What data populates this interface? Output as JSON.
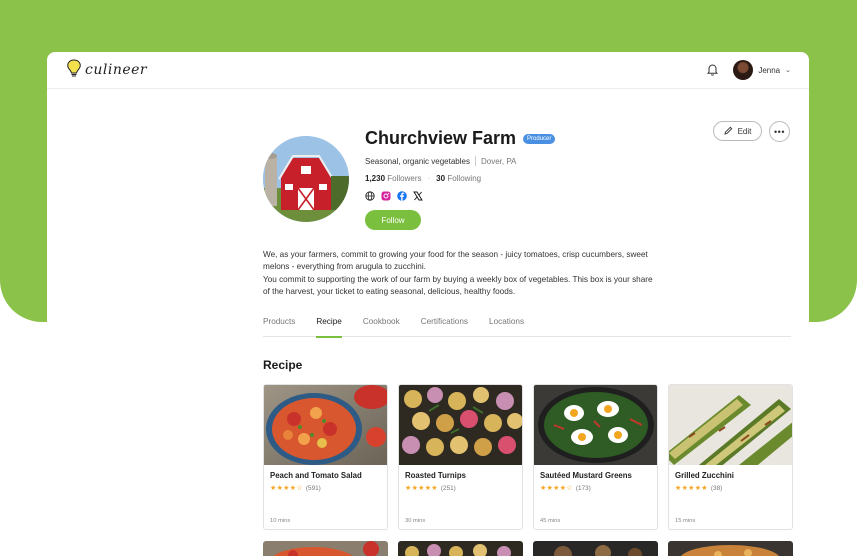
{
  "app": {
    "logo_text": "culineer"
  },
  "header": {
    "user_name": "Jenna"
  },
  "profile": {
    "name": "Churchview Farm",
    "badge": "Producer",
    "tagline": "Seasonal, organic vegetables",
    "location": "Dover, PA",
    "followers_count": "1,230",
    "followers_label": "Followers",
    "following_count": "30",
    "following_label": "Following",
    "follow_label": "Follow",
    "edit_label": "Edit",
    "more_label": "•••",
    "socials": [
      "globe-icon",
      "instagram-icon",
      "facebook-icon",
      "x-icon"
    ],
    "description": [
      "We, as your farmers, commit to growing your food for the season - juicy tomatoes, crisp cucumbers, sweet melons - everything from arugula to zucchini.",
      "You commit to supporting the work of our farm by buying a weekly box of vegetables. This box is your share of the harvest, your ticket to eating seasonal, delicious, healthy foods."
    ]
  },
  "tabs": [
    {
      "label": "Products"
    },
    {
      "label": "Recipe",
      "active": true
    },
    {
      "label": "Cookbook"
    },
    {
      "label": "Certifications"
    },
    {
      "label": "Locations"
    }
  ],
  "section_title": "Recipe",
  "recipes": [
    {
      "title": "Peach and Tomato Salad",
      "stars": "★★★★☆",
      "count": "(591)",
      "time": "10 mins"
    },
    {
      "title": "Roasted Turnips",
      "stars": "★★★★★",
      "count": "(251)",
      "time": "30 mins"
    },
    {
      "title": "Sautéed Mustard Greens",
      "stars": "★★★★☆",
      "count": "(173)",
      "time": "45 mins"
    },
    {
      "title": "Grilled Zucchini",
      "stars": "★★★★★",
      "count": "(38)",
      "time": "15 mins"
    }
  ],
  "colors": {
    "brand_green": "#8bc34a",
    "follow_green": "#7bbf3e",
    "badge_blue": "#4a90e2",
    "star": "#f5a623"
  }
}
